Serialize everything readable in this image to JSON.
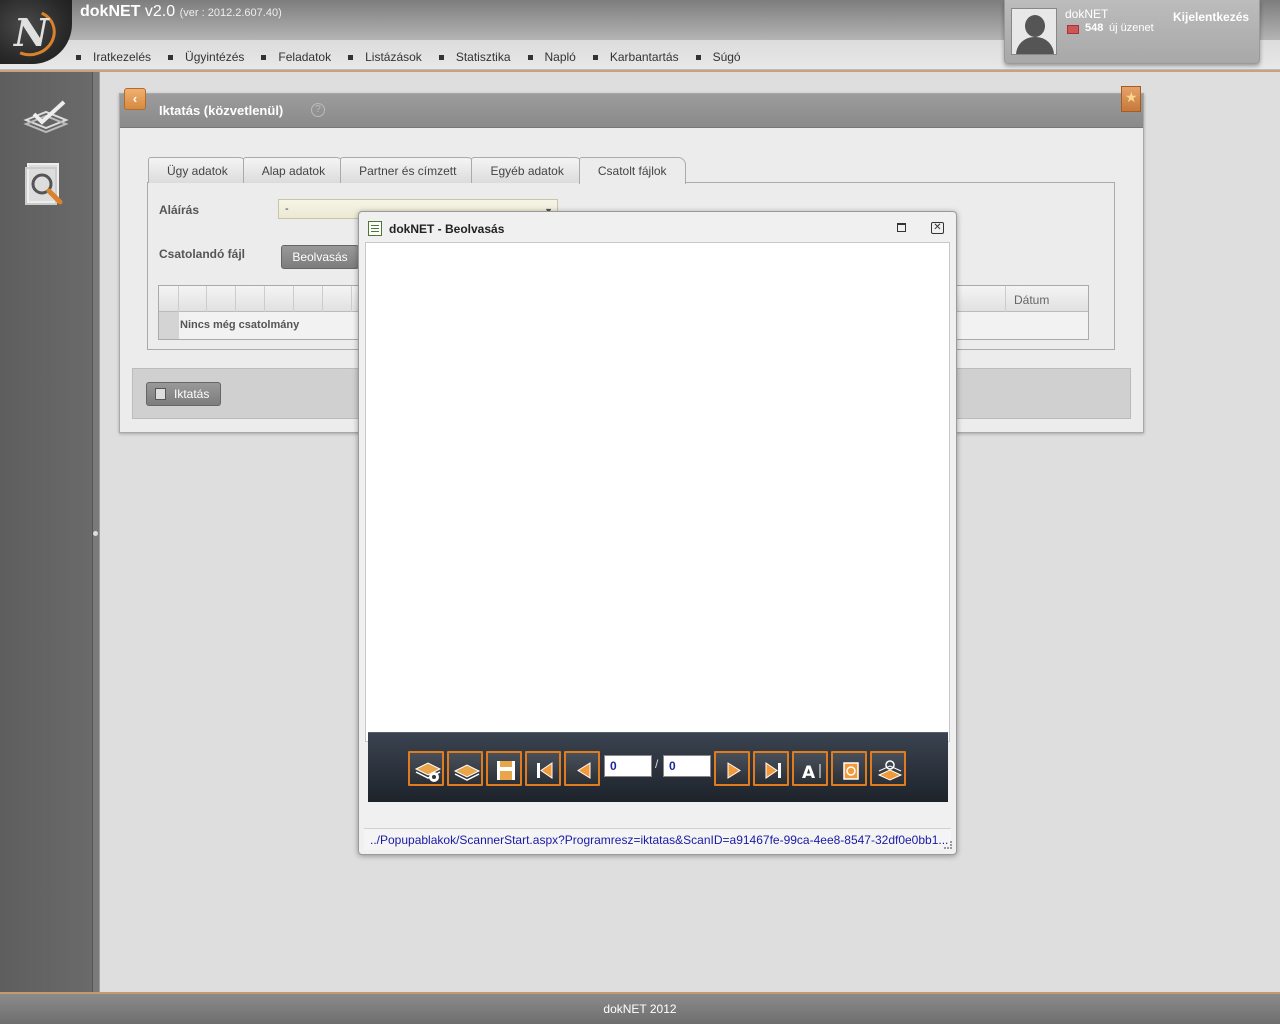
{
  "app": {
    "name": "dokNET",
    "version": "v2.0",
    "build": "(ver : 2012.2.607.40)"
  },
  "nav": {
    "items": [
      "Iratkezelés",
      "Ügyintézés",
      "Feladatok",
      "Listázások",
      "Statisztika",
      "Napló",
      "Karbantartás",
      "Súgó"
    ]
  },
  "user": {
    "name": "dokNET",
    "message_count": "548",
    "message_label": "új üzenet",
    "logout": "Kijelentkezés"
  },
  "panel": {
    "title": "Iktatás (közvetlenül)",
    "help": "?",
    "back": "‹",
    "tabs": [
      "Ügy adatok",
      "Alap adatok",
      "Partner és címzett",
      "Egyéb adatok",
      "Csatolt fájlok"
    ],
    "active_tab": "Csatolt fájlok",
    "signature_label": "Aláírás",
    "signature_value": "-",
    "attach_label": "Csatolandó fájl",
    "scan_button": "Beolvasás",
    "grid_date_header": "Dátum",
    "grid_empty": "Nincs még csatolmány",
    "submit_button": "Iktatás"
  },
  "popup": {
    "title": "dokNET - Beolvasás",
    "page_current": "0",
    "page_total": "0",
    "page_separator": "/",
    "status_url": "../Popupablakok/ScannerStart.aspx?Programresz=iktatas&ScanID=a91467fe-99ca-4ee8-8547-32df0e0bb1..."
  },
  "footer": {
    "text": "dokNET 2012"
  },
  "colors": {
    "accent": "#e07b1e",
    "header_gray": "#9a9a9a",
    "link_blue": "#1a1aa8"
  }
}
